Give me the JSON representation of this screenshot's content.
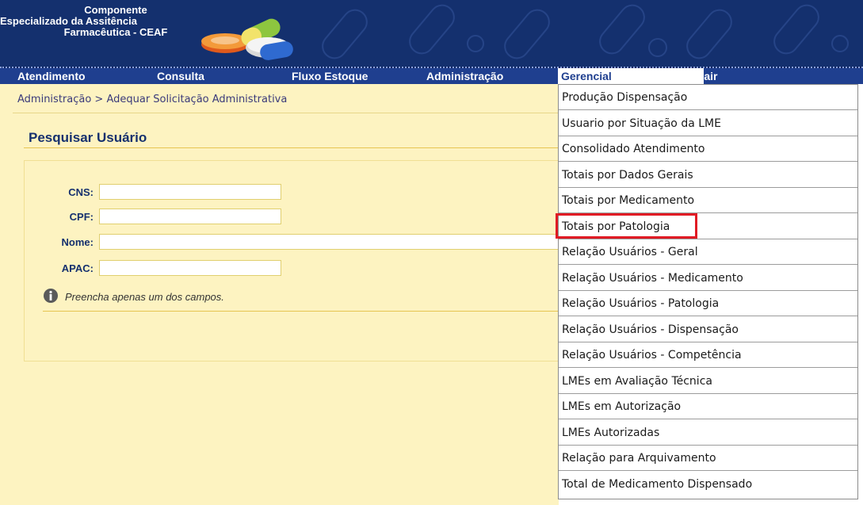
{
  "header": {
    "logo_line1": "Componente",
    "logo_line2": "Especializado da Assitência",
    "logo_line3": "Farmacêutica - CEAF"
  },
  "menu": [
    {
      "label": "Atendimento"
    },
    {
      "label": "Consulta"
    },
    {
      "label": "Fluxo Estoque"
    },
    {
      "label": "Administração"
    },
    {
      "label": "Gerencial"
    },
    {
      "label": "Sair"
    }
  ],
  "breadcrumb": "Administração > Adequar Solicitação Administrativa",
  "section_title": "Pesquisar Usuário",
  "form": {
    "cns_label": "CNS:",
    "cpf_label": "CPF:",
    "nome_label": "Nome:",
    "apac_label": "APAC:",
    "cns_value": "",
    "cpf_value": "",
    "nome_value": "",
    "apac_value": "",
    "hint": "Preencha apenas um dos campos."
  },
  "dropdown": {
    "items": [
      {
        "label": "Produção Dispensação"
      },
      {
        "label": "Usuario por Situação da LME"
      },
      {
        "label": "Consolidado Atendimento"
      },
      {
        "label": "Totais por Dados Gerais"
      },
      {
        "label": "Totais por Medicamento"
      },
      {
        "label": "Totais por Patologia"
      },
      {
        "label": "Relação Usuários - Geral"
      },
      {
        "label": "Relação Usuários - Medicamento"
      },
      {
        "label": "Relação Usuários - Patologia"
      },
      {
        "label": "Relação Usuários - Dispensação"
      },
      {
        "label": "Relação Usuários - Competência"
      },
      {
        "label": "LMEs em Avaliação Técnica"
      },
      {
        "label": "LMEs em Autorização"
      },
      {
        "label": "LMEs Autorizadas"
      },
      {
        "label": "Relação para Arquivamento"
      },
      {
        "label": "Total de Medicamento Dispensado"
      }
    ],
    "highlighted": "Totais por Patologia"
  },
  "colors": {
    "header_bg": "#14306e",
    "menubar_bg": "#1f3f8f",
    "content_bg": "#fdf3c1",
    "highlight": "#e01b24"
  }
}
